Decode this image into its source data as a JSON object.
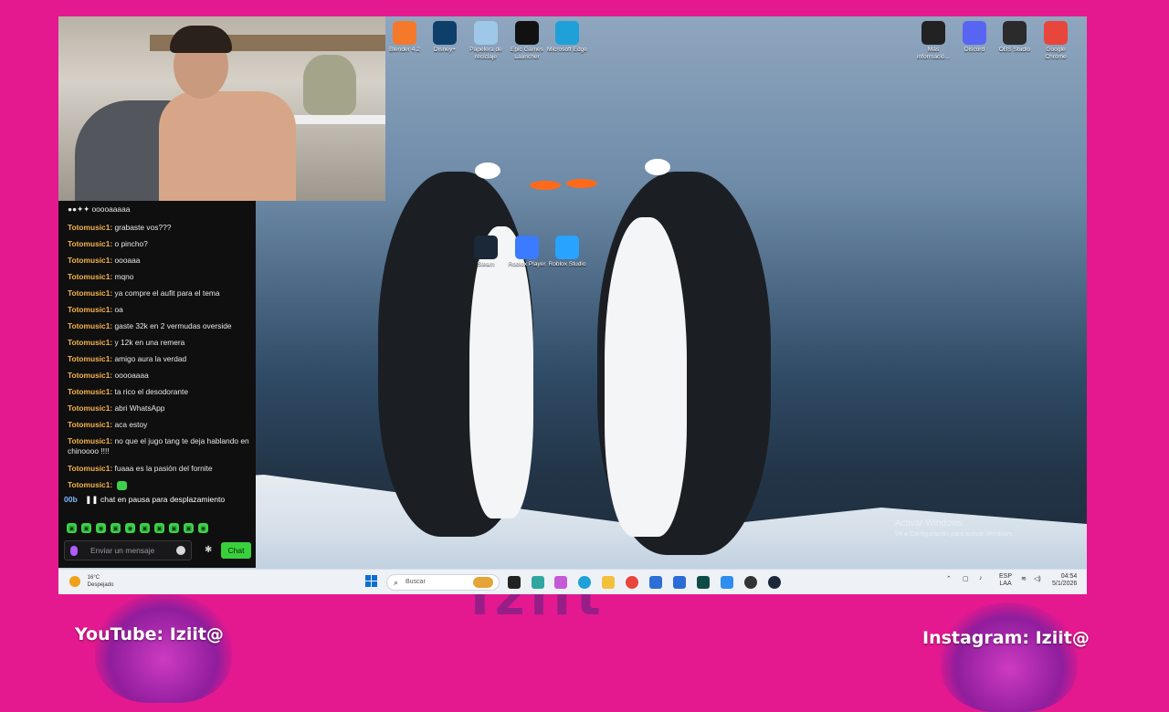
{
  "overlay": {
    "background_word": "Iziit",
    "youtube_label": "YouTube: Iziit@",
    "instagram_label": "Instagram: Iziit@",
    "brand_color": "#e4198f"
  },
  "chat": {
    "top_message": "ooooaaaaa",
    "messages": [
      {
        "user": "Totomusic1:",
        "text": "grabaste vos???"
      },
      {
        "user": "Totomusic1:",
        "text": "o pincho?"
      },
      {
        "user": "Totomusic1:",
        "text": "oooaaa"
      },
      {
        "user": "Totomusic1:",
        "text": "mqno"
      },
      {
        "user": "Totomusic1:",
        "text": "ya compre el aufit para el tema"
      },
      {
        "user": "Totomusic1:",
        "text": "oa"
      },
      {
        "user": "Totomusic1:",
        "text": "gaste 32k en 2 vermudas overside"
      },
      {
        "user": "Totomusic1:",
        "text": "y 12k en una remera"
      },
      {
        "user": "Totomusic1:",
        "text": "amigo aura la verdad"
      },
      {
        "user": "Totomusic1:",
        "text": "ooooaaaa"
      },
      {
        "user": "Totomusic1:",
        "text": "ta rico el desodorante"
      },
      {
        "user": "Totomusic1:",
        "text": "abri WhatsApp"
      },
      {
        "user": "Totomusic1:",
        "text": "aca estoy"
      },
      {
        "user": "Totomusic1:",
        "text": "no que el jugo tang te deja hablando en chinoooo !!!!"
      },
      {
        "user": "Totomusic1:",
        "text": "fuaaa es la pasión del fornite"
      },
      {
        "user": "Totomusic1:",
        "text": ""
      }
    ],
    "pause_bits": "00b",
    "pause_text": "chat en pausa para desplazamiento",
    "input_placeholder": "Enviar un mensaje",
    "chat_button": "Chat",
    "accent_color": "#39d13b"
  },
  "desktop": {
    "top_icons": [
      {
        "label": "Blender 4.2",
        "icon": "blender-icon",
        "color": "#f5792a"
      },
      {
        "label": "Disney+",
        "icon": "disney-plus-icon",
        "color": "#0e3f6b"
      },
      {
        "label": "Papelera de reciclaje",
        "icon": "recycle-bin-icon",
        "color": "#9ec7e8"
      },
      {
        "label": "Epic Games Launcher",
        "icon": "epic-games-icon",
        "color": "#111111"
      },
      {
        "label": "Microsoft Edge",
        "icon": "edge-icon",
        "color": "#1fa0d8"
      }
    ],
    "right_icons": [
      {
        "label": "Más informació...",
        "icon": "info-icon",
        "color": "#222222"
      },
      {
        "label": "Discord",
        "icon": "discord-icon",
        "color": "#5865f2"
      },
      {
        "label": "OBS Studio",
        "icon": "obs-icon",
        "color": "#2b2b2b"
      },
      {
        "label": "Google Chrome",
        "icon": "chrome-icon",
        "color": "#e8453c"
      }
    ],
    "mid_icons": [
      {
        "label": "Steam",
        "icon": "steam-icon",
        "color": "#1b2838"
      },
      {
        "label": "Roblox Player",
        "icon": "roblox-player-icon",
        "color": "#3a7bff"
      },
      {
        "label": "Roblox Studio",
        "icon": "roblox-studio-icon",
        "color": "#28a3ff"
      }
    ],
    "watermark_title": "Activar Windows",
    "watermark_sub": "Ve a Configuración para activar Windows."
  },
  "taskbar": {
    "weather_temp": "16°C",
    "weather_desc": "Despejado",
    "search_placeholder": "Buscar",
    "lang_top": "ESP",
    "lang_bottom": "LAA",
    "time": "04:54",
    "date": "5/1/2026"
  }
}
